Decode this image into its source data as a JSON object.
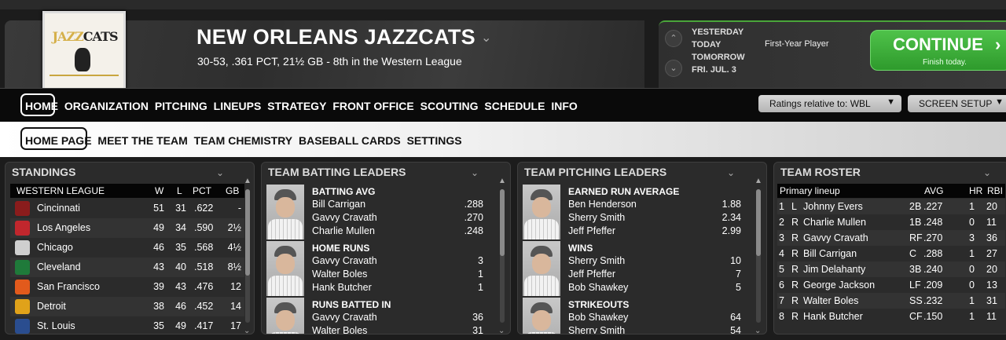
{
  "header": {
    "team_name": "NEW ORLEANS JAZZCATS",
    "record_line": "30-53, .361 PCT, 21½ GB - 8th in the Western League",
    "logo_text_main": "JAZZ",
    "logo_text_second": "CATS"
  },
  "dates": {
    "yesterday": "YESTERDAY",
    "today": "TODAY",
    "tomorrow": "TOMORROW",
    "date": "FRI. JUL. 3",
    "event": "First-Year Player"
  },
  "continue_button": {
    "label": "CONTINUE",
    "sub": "Finish today.",
    "chevron": "›"
  },
  "nav_main": [
    "HOME",
    "ORGANIZATION",
    "PITCHING",
    "LINEUPS",
    "STRATEGY",
    "FRONT OFFICE",
    "SCOUTING",
    "SCHEDULE",
    "INFO"
  ],
  "nav_sub": [
    "HOME PAGE",
    "MEET THE TEAM",
    "TEAM CHEMISTRY",
    "BASEBALL CARDS",
    "SETTINGS"
  ],
  "ratings_dropdown": "Ratings relative to: WBL",
  "screen_setup": "SCREEN SETUP",
  "standings": {
    "title": "STANDINGS",
    "league": "WESTERN LEAGUE",
    "cols": [
      "W",
      "L",
      "PCT",
      "GB"
    ],
    "rows": [
      {
        "team": "Cincinnati",
        "w": "51",
        "l": "31",
        "pct": ".622",
        "gb": "-",
        "color": "#8a1c1c"
      },
      {
        "team": "Los Angeles",
        "w": "49",
        "l": "34",
        "pct": ".590",
        "gb": "2½",
        "color": "#c1272d"
      },
      {
        "team": "Chicago",
        "w": "46",
        "l": "35",
        "pct": ".568",
        "gb": "4½",
        "color": "#cfcfcf"
      },
      {
        "team": "Cleveland",
        "w": "43",
        "l": "40",
        "pct": ".518",
        "gb": "8½",
        "color": "#1f7a3a"
      },
      {
        "team": "San Francisco",
        "w": "39",
        "l": "43",
        "pct": ".476",
        "gb": "12",
        "color": "#e25a1c"
      },
      {
        "team": "Detroit",
        "w": "38",
        "l": "46",
        "pct": ".452",
        "gb": "14",
        "color": "#e0a21a"
      },
      {
        "team": "St. Louis",
        "w": "35",
        "l": "49",
        "pct": ".417",
        "gb": "17",
        "color": "#2a4d8f"
      }
    ]
  },
  "batting": {
    "title": "TEAM BATTING LEADERS",
    "cats": [
      {
        "name": "BATTING AVG",
        "rows": [
          {
            "p": "Bill Carrigan",
            "v": ".288"
          },
          {
            "p": "Gavvy Cravath",
            "v": ".270"
          },
          {
            "p": "Charlie Mullen",
            "v": ".248"
          }
        ]
      },
      {
        "name": "HOME RUNS",
        "rows": [
          {
            "p": "Gavvy Cravath",
            "v": "3"
          },
          {
            "p": "Walter Boles",
            "v": "1"
          },
          {
            "p": "Hank Butcher",
            "v": "1"
          }
        ]
      },
      {
        "name": "RUNS BATTED IN",
        "rows": [
          {
            "p": "Gavvy Cravath",
            "v": "36"
          },
          {
            "p": "Walter Boles",
            "v": "31"
          }
        ]
      }
    ]
  },
  "pitching": {
    "title": "TEAM PITCHING LEADERS",
    "cats": [
      {
        "name": "EARNED RUN AVERAGE",
        "rows": [
          {
            "p": "Ben Henderson",
            "v": "1.88"
          },
          {
            "p": "Sherry Smith",
            "v": "2.34"
          },
          {
            "p": "Jeff Pfeffer",
            "v": "2.99"
          }
        ]
      },
      {
        "name": "WINS",
        "rows": [
          {
            "p": "Sherry Smith",
            "v": "10"
          },
          {
            "p": "Jeff Pfeffer",
            "v": "7"
          },
          {
            "p": "Bob Shawkey",
            "v": "5"
          }
        ]
      },
      {
        "name": "STRIKEOUTS",
        "rows": [
          {
            "p": "Bob Shawkey",
            "v": "64"
          },
          {
            "p": "Sherry Smith",
            "v": "54"
          }
        ]
      }
    ]
  },
  "roster": {
    "title": "TEAM ROSTER",
    "lineup_label": "Primary lineup",
    "cols": [
      "AVG",
      "HR",
      "RBI"
    ],
    "rows": [
      {
        "n": "1",
        "h": "L",
        "name": "Johnny Evers",
        "pos": "2B",
        "avg": ".227",
        "hr": "1",
        "rbi": "20"
      },
      {
        "n": "2",
        "h": "R",
        "name": "Charlie Mullen",
        "pos": "1B",
        "avg": ".248",
        "hr": "0",
        "rbi": "11"
      },
      {
        "n": "3",
        "h": "R",
        "name": "Gavvy Cravath",
        "pos": "RF",
        "avg": ".270",
        "hr": "3",
        "rbi": "36"
      },
      {
        "n": "4",
        "h": "R",
        "name": "Bill Carrigan",
        "pos": "C",
        "avg": ".288",
        "hr": "1",
        "rbi": "27"
      },
      {
        "n": "5",
        "h": "R",
        "name": "Jim Delahanty",
        "pos": "3B",
        "avg": ".240",
        "hr": "0",
        "rbi": "20"
      },
      {
        "n": "6",
        "h": "R",
        "name": "George Jackson",
        "pos": "LF",
        "avg": ".209",
        "hr": "0",
        "rbi": "13"
      },
      {
        "n": "7",
        "h": "R",
        "name": "Walter Boles",
        "pos": "SS",
        "avg": ".232",
        "hr": "1",
        "rbi": "31"
      },
      {
        "n": "8",
        "h": "R",
        "name": "Hank Butcher",
        "pos": "CF",
        "avg": ".150",
        "hr": "1",
        "rbi": "11"
      }
    ]
  }
}
